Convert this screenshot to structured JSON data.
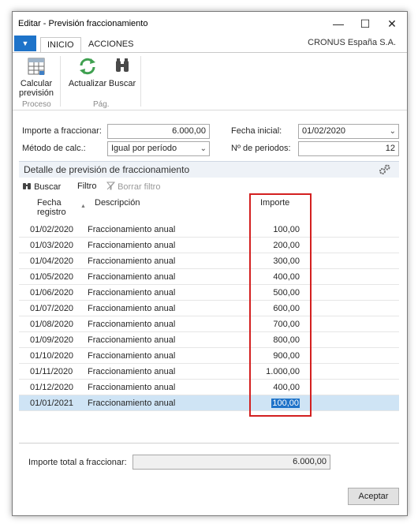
{
  "window": {
    "title": "Editar - Previsión fraccionamiento",
    "minimize_glyph": "—",
    "maximize_glyph": "☐",
    "close_glyph": "✕"
  },
  "ribbon": {
    "menu_glyph": "▼",
    "tabs": [
      "INICIO",
      "ACCIONES"
    ],
    "company": "CRONUS España S.A.",
    "buttons": {
      "calcular": "Calcular previsión",
      "actualizar": "Actualizar",
      "buscar": "Buscar"
    },
    "groups": [
      "Proceso",
      "Pág."
    ]
  },
  "form": {
    "importe_label": "Importe a fraccionar:",
    "importe_value": "6.000,00",
    "fecha_label": "Fecha inicial:",
    "fecha_value": "01/02/2020",
    "metodo_label": "Método de calc.:",
    "metodo_value": "Igual por período",
    "periodos_label": "Nº de periodos:",
    "periodos_value": "12",
    "dropdown_glyph": "⌄"
  },
  "part": {
    "title": "Detalle de previsión de fraccionamiento",
    "toolbar": {
      "buscar": "Buscar",
      "filtro": "Filtro",
      "borrar_filtro": "Borrar filtro"
    },
    "columns": {
      "fecha_line1": "Fecha",
      "fecha_line2": "registro",
      "sort_glyph": "▲",
      "descripcion": "Descripción",
      "importe": "Importe"
    },
    "rows": [
      {
        "fecha": "01/02/2020",
        "desc": "Fraccionamiento anual",
        "importe": "100,00"
      },
      {
        "fecha": "01/03/2020",
        "desc": "Fraccionamiento anual",
        "importe": "200,00"
      },
      {
        "fecha": "01/04/2020",
        "desc": "Fraccionamiento anual",
        "importe": "300,00"
      },
      {
        "fecha": "01/05/2020",
        "desc": "Fraccionamiento anual",
        "importe": "400,00"
      },
      {
        "fecha": "01/06/2020",
        "desc": "Fraccionamiento anual",
        "importe": "500,00"
      },
      {
        "fecha": "01/07/2020",
        "desc": "Fraccionamiento anual",
        "importe": "600,00"
      },
      {
        "fecha": "01/08/2020",
        "desc": "Fraccionamiento anual",
        "importe": "700,00"
      },
      {
        "fecha": "01/09/2020",
        "desc": "Fraccionamiento anual",
        "importe": "800,00"
      },
      {
        "fecha": "01/10/2020",
        "desc": "Fraccionamiento anual",
        "importe": "900,00"
      },
      {
        "fecha": "01/11/2020",
        "desc": "Fraccionamiento anual",
        "importe": "1.000,00"
      },
      {
        "fecha": "01/12/2020",
        "desc": "Fraccionamiento anual",
        "importe": "400,00"
      },
      {
        "fecha": "01/01/2021",
        "desc": "Fraccionamiento anual",
        "importe": "100,00"
      }
    ],
    "selected_row_index": 11
  },
  "footer": {
    "total_label": "Importe total a fraccionar:",
    "total_value": "6.000,00",
    "accept_label": "Aceptar"
  },
  "colors": {
    "accent": "#1e73c9",
    "selected_row": "#cfe4f5",
    "highlight_box": "#d32020"
  }
}
